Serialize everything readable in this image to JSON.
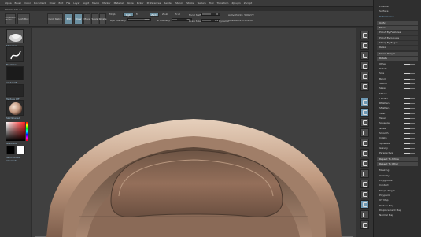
{
  "menu": [
    "Alpha",
    "Brush",
    "Color",
    "Document",
    "Draw",
    "Edit",
    "File",
    "Layer",
    "Light",
    "Macro",
    "Marker",
    "Material",
    "Movie",
    "Picker",
    "Preferences",
    "Render",
    "Stencil",
    "Stroke",
    "Texture",
    "Tool",
    "Transform",
    "Zplugin",
    "Zscript"
  ],
  "subtitle": "ZBrush 4R7 P3",
  "topbar": {
    "projection_label": "Projection Master",
    "lightbox_label": "LightBox",
    "quicksketch_label": "Quick Sketch",
    "edit_label": "Edit",
    "draw_label": "Draw",
    "move_label": "Move",
    "scale_label": "Scale",
    "rotate_label": "Rotate",
    "mrgb_label": "Mrgb",
    "rgb_label": "Rgb",
    "m_label": "M",
    "zadd_label": "Zadd",
    "zsub_label": "Zsub",
    "zcut_label": "Zcut",
    "rgb_intensity_label": "Rgb Intensity",
    "rgb_intensity_value": "100",
    "z_intensity_label": "Z Intensity",
    "z_intensity_value": "25",
    "focal_shift_label": "Focal Shift",
    "focal_shift_value": "0",
    "draw_size_label": "Draw Size",
    "draw_size_value": "64",
    "dynamic_label": "Dynamic",
    "active_points": "ActivePoints: 506,272",
    "total_points": "TotalPoints: 1.031 Mil",
    "levels": {
      "rgb_intensity": 1.0,
      "z_intensity": 0.25,
      "focal_shift": 0.5,
      "draw_size": 0.5
    }
  },
  "leftshelf": {
    "brush_label": "Standard",
    "stroke_label": "FreeHand",
    "alpha_label": "Alpha Off",
    "texture_label": "Texture Off",
    "material_label": "SkinShade4",
    "gradient_label": "Gradient",
    "switch_label": "SwitchColor",
    "alternate_label": "Alternate"
  },
  "rightshelf": [
    "BPR",
    "SPix",
    "Scroll",
    "Zoom",
    "Actual",
    "AAHalf",
    "Persp",
    "Floor",
    "Local",
    "L.Sym",
    "Frame",
    "Move",
    "Scale",
    "Rotate",
    "Line Fill",
    "PolyF",
    "Transp",
    "Ghost",
    "Solo",
    "Xpose"
  ],
  "tray": {
    "items": [
      {
        "label": "Preview",
        "kind": "plain"
      },
      {
        "label": "Surface",
        "kind": "plain"
      },
      {
        "label": "Deformation",
        "kind": "blue"
      },
      {
        "label": "Unify",
        "kind": "header"
      },
      {
        "label": "Mirror",
        "kind": "header"
      },
      {
        "label": "Polish By Features",
        "kind": "sub"
      },
      {
        "label": "Polish By Groups",
        "kind": "sub"
      },
      {
        "label": "Sharp By Edges",
        "kind": "sub"
      },
      {
        "label": "Relax",
        "kind": "sub"
      },
      {
        "label": "Smart Resym",
        "kind": "header"
      },
      {
        "label": "Rotate",
        "kind": "header"
      },
      {
        "label": "Offset",
        "kind": "plain",
        "level": 0.5
      },
      {
        "label": "Rotate",
        "kind": "plain",
        "level": 0.5
      },
      {
        "label": "Size",
        "kind": "plain",
        "level": 0.5
      },
      {
        "label": "Bend",
        "kind": "plain",
        "level": 0.5
      },
      {
        "label": "SBend",
        "kind": "plain",
        "level": 0.5
      },
      {
        "label": "Skew",
        "kind": "plain",
        "level": 0.5
      },
      {
        "label": "SSkew",
        "kind": "plain",
        "level": 0.5
      },
      {
        "label": "Flatten",
        "kind": "plain",
        "level": 0.5
      },
      {
        "label": "RFlatten",
        "kind": "plain",
        "level": 0.5
      },
      {
        "label": "SFlatten",
        "kind": "plain",
        "level": 0.5
      },
      {
        "label": "Twist",
        "kind": "plain",
        "level": 0.5
      },
      {
        "label": "Taper",
        "kind": "plain",
        "level": 0.5
      },
      {
        "label": "Squeeze",
        "kind": "plain",
        "level": 0.5
      },
      {
        "label": "Noise",
        "kind": "plain",
        "level": 0.5
      },
      {
        "label": "Smooth",
        "kind": "plain",
        "level": 0.5
      },
      {
        "label": "Inflate",
        "kind": "plain",
        "level": 0.5
      },
      {
        "label": "Spherize",
        "kind": "plain",
        "level": 0.5
      },
      {
        "label": "Gravity",
        "kind": "plain",
        "level": 0.5
      },
      {
        "label": "Perspective",
        "kind": "plain",
        "level": 0.5
      },
      {
        "label": "Repeat To Active",
        "kind": "header"
      },
      {
        "label": "Repeat To Other",
        "kind": "header"
      },
      {
        "label": "Masking",
        "kind": "plain"
      },
      {
        "label": "Visibility",
        "kind": "plain"
      },
      {
        "label": "Polygroups",
        "kind": "plain"
      },
      {
        "label": "Contact",
        "kind": "plain"
      },
      {
        "label": "Morph Target",
        "kind": "plain"
      },
      {
        "label": "Polypaint",
        "kind": "plain"
      },
      {
        "label": "UV Map",
        "kind": "plain"
      },
      {
        "label": "Texture Map",
        "kind": "plain"
      },
      {
        "label": "Displacement Map",
        "kind": "plain"
      },
      {
        "label": "Normal Map",
        "kind": "plain"
      }
    ]
  },
  "colors": {
    "accent": "#6f99b4",
    "model": "#c8a890",
    "canvas": "#404040"
  }
}
